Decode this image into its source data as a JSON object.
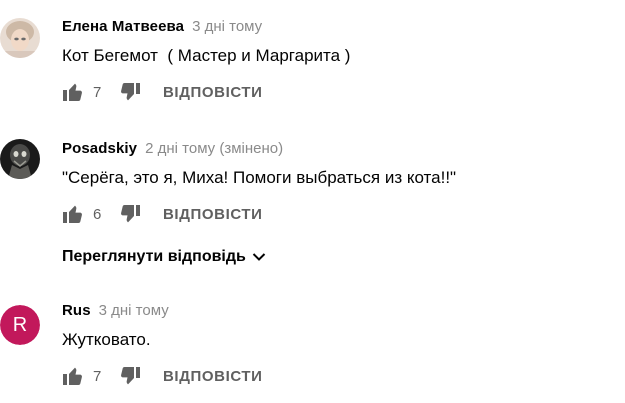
{
  "comments": [
    {
      "author": "Елена Матвеева",
      "time": "3 дні тому",
      "edited": "",
      "text": "Кот Бегемот  ( Мастер и Маргарита )",
      "likes": "7",
      "reply_label": "ВІДПОВІСТИ",
      "avatar_icon": "photo-avatar"
    },
    {
      "author": "Posadskiy",
      "time": "2 дні тому (змінено)",
      "edited": "",
      "text": "\"Серёга, это я, Миха! Помоги выбраться из кота!!\"",
      "likes": "6",
      "reply_label": "ВІДПОВІСТИ",
      "avatar_icon": "dark-photo-avatar"
    },
    {
      "author": "Rus",
      "time": "3 дні тому",
      "edited": "",
      "text": "Жутковато.",
      "likes": "7",
      "reply_label": "ВІДПОВІСТИ",
      "avatar_letter": "R",
      "avatar_color": "#c2185b"
    }
  ],
  "view_replies_label": "Переглянути відповідь",
  "icons": {
    "like": "thumb-up-icon",
    "dislike": "thumb-down-icon",
    "expand": "chevron-down-icon"
  },
  "colors": {
    "meta": "#8a8a8a",
    "action": "#606060",
    "avatar_r": "#c2185b"
  }
}
